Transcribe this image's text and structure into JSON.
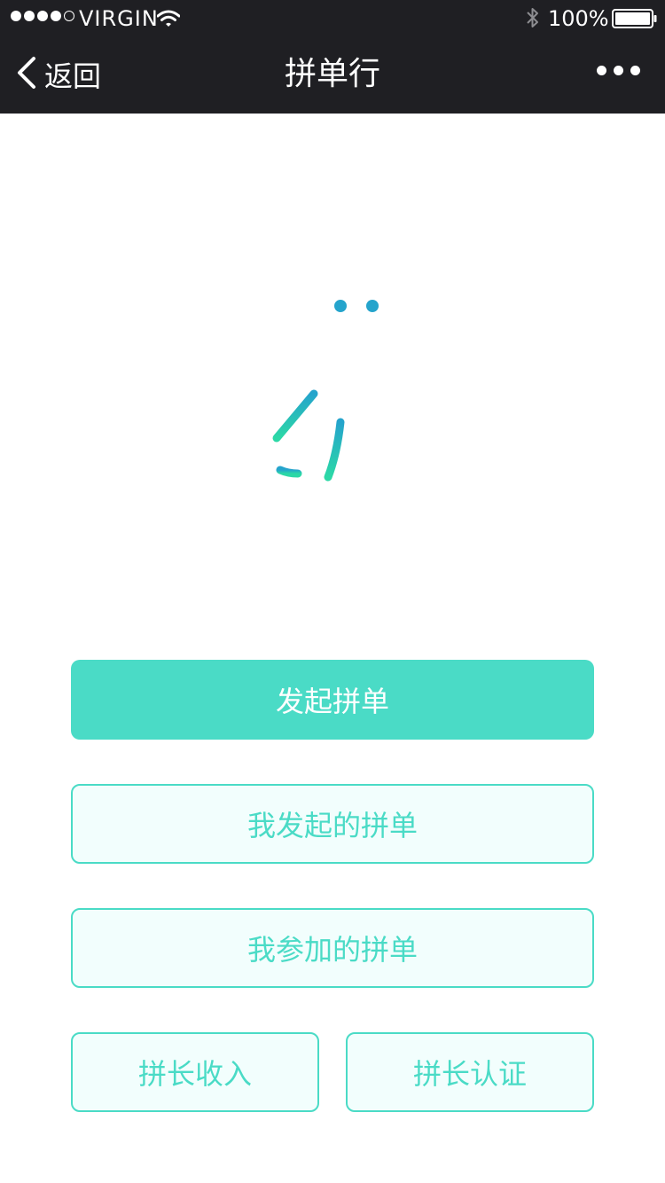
{
  "status_bar": {
    "carrier": "VIRGIN",
    "battery": "100%",
    "signal_bars_filled": 4,
    "signal_bars_total": 5
  },
  "nav": {
    "back_label": "返回",
    "title": "拼单行"
  },
  "logo": {
    "icon": "pin-character-logo"
  },
  "buttons": {
    "start_group": "发起拼单",
    "my_initiated": "我发起的拼单",
    "my_joined": "我参加的拼单",
    "leader_income": "拼长收入",
    "leader_cert": "拼长认证"
  },
  "colors": {
    "accent": "#4adbc6",
    "accent_light_bg": "#f2fefd",
    "nav_bg": "#1f1f23",
    "logo_gradient_top": "#25a4cc",
    "logo_gradient_bottom": "#2cd8a6"
  }
}
